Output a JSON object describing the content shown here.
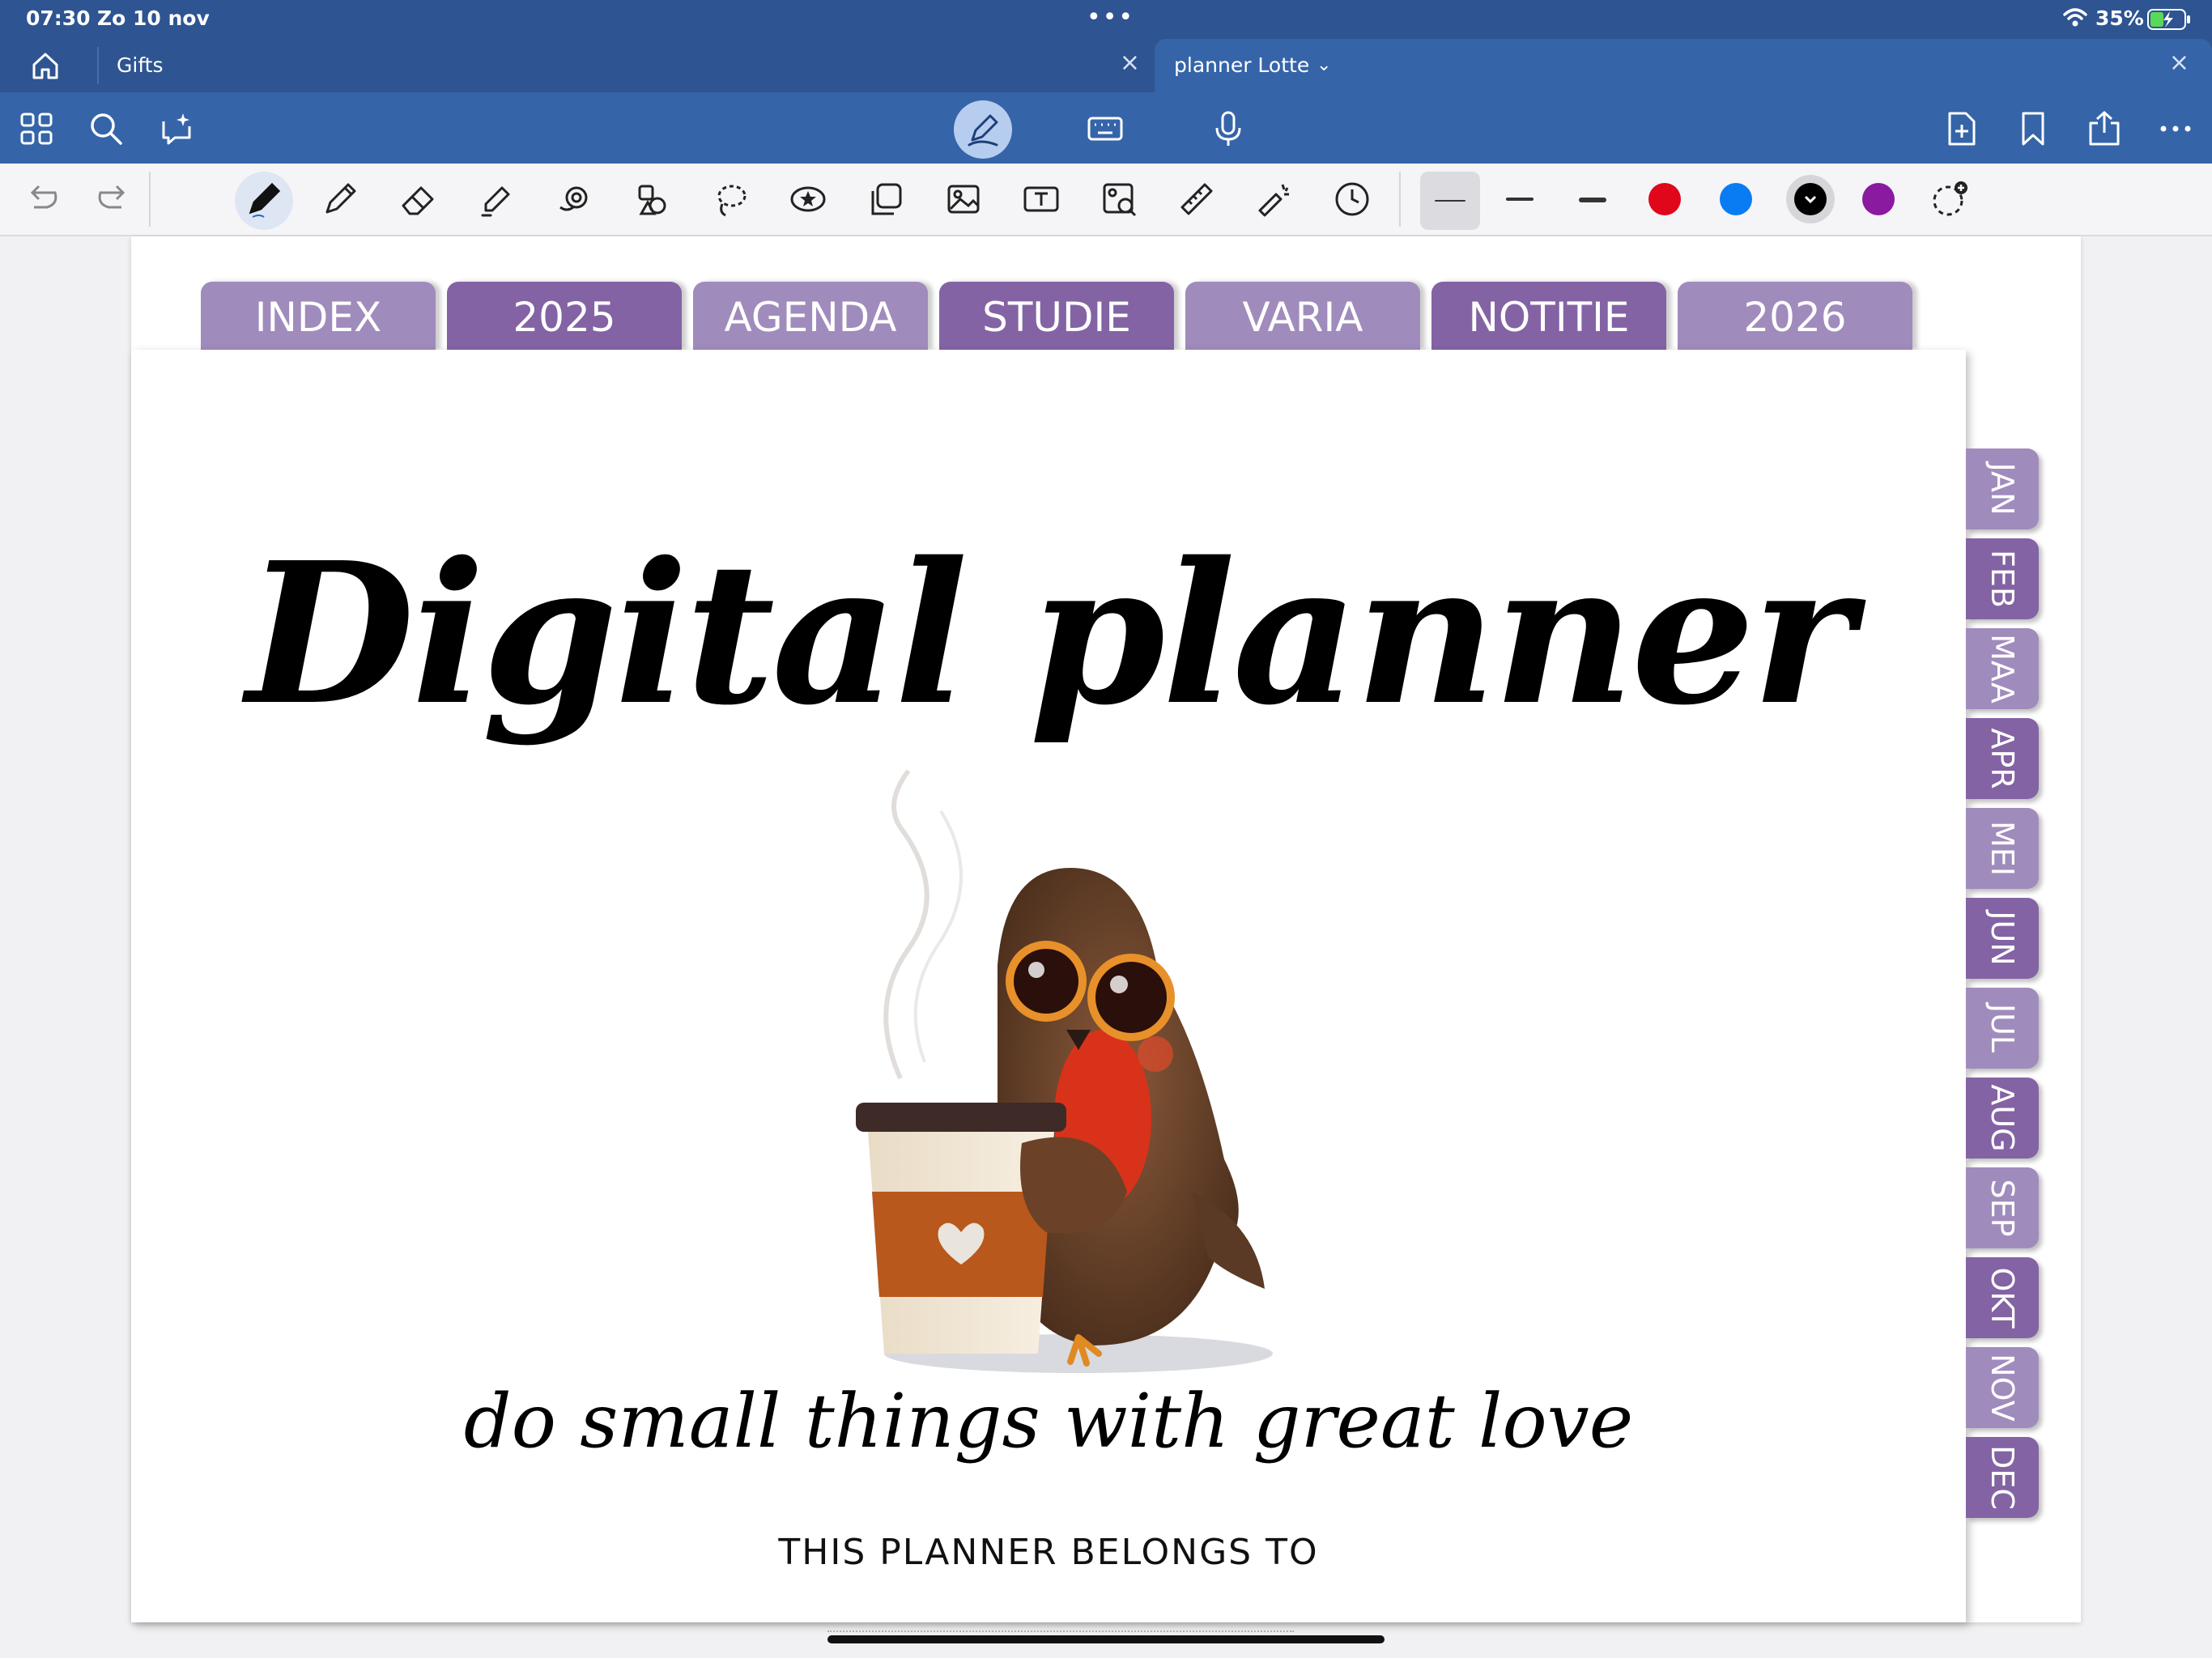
{
  "status_bar": {
    "time": "07:30",
    "date": "Zo 10 nov",
    "battery_pct": "35%"
  },
  "tabs": [
    {
      "label": "Gifts"
    },
    {
      "label": "planner Lotte"
    }
  ],
  "colors": {
    "status_bar": "#2e5491",
    "toolbar": "#3564a8",
    "tab_light": "#a08bbd",
    "tab_dark": "#8363a4",
    "swatch_red": "#e0071b",
    "swatch_blue": "#0a7cf3",
    "swatch_black": "#000000",
    "swatch_purple": "#8a1aa0"
  },
  "icons": {
    "main_toolbar": [
      "grid-icon",
      "search-icon",
      "ai-chat-icon",
      "pen-mode-icon",
      "keyboard-icon",
      "microphone-icon",
      "add-page-icon",
      "bookmark-icon",
      "share-icon",
      "more-icon"
    ],
    "tools": [
      "undo-icon",
      "redo-icon",
      "pen-icon",
      "pencil-icon",
      "eraser-icon",
      "highlighter-icon",
      "shapes-icon",
      "elements-icon",
      "lasso-icon",
      "sticker-icon",
      "image-icon",
      "text-icon",
      "camera-icon",
      "ruler-icon",
      "laser-icon",
      "clock-icon"
    ]
  },
  "planner": {
    "top_tabs": [
      "INDEX",
      "2025",
      "AGENDA",
      "STUDIE",
      "VARIA",
      "NOTITIE",
      "2026"
    ],
    "month_tabs": [
      "JAN",
      "FEB",
      "MAA",
      "APR",
      "MEI",
      "JUN",
      "JUL",
      "AUG",
      "SEP",
      "OKT",
      "NOV",
      "DEC"
    ],
    "title": "Digital planner",
    "tagline": "do small things with great love",
    "belongs_label": "THIS PLANNER BELONGS TO"
  }
}
